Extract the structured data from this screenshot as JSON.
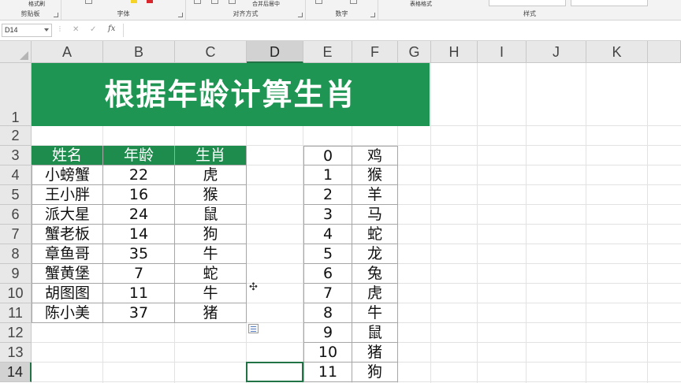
{
  "ribbon": {
    "groups": [
      {
        "label": "剪贴板",
        "button": "格式刷"
      },
      {
        "label": "字体"
      },
      {
        "label": "对齐方式",
        "button": "合并后居中"
      },
      {
        "label": "数字"
      },
      {
        "label": "样式",
        "button": "表格格式"
      }
    ],
    "colors": {
      "highlight": "#f5d327",
      "font_color": "#d9262c"
    }
  },
  "formula_bar": {
    "name_box": "D14",
    "cancel_icon": "✕",
    "enter_icon": "✓",
    "fx_label": "fx",
    "content": ""
  },
  "sheet": {
    "columns": [
      "A",
      "B",
      "C",
      "D",
      "E",
      "F",
      "G",
      "H",
      "I",
      "J",
      "K"
    ],
    "rows": [
      "1",
      "2",
      "3",
      "4",
      "5",
      "6",
      "7",
      "8",
      "9",
      "10",
      "11",
      "12",
      "13",
      "14"
    ],
    "selected_cell": "D14",
    "title": "根据年龄计算生肖",
    "main_table": {
      "headers": [
        "姓名",
        "年龄",
        "生肖"
      ],
      "rows": [
        [
          "小螃蟹",
          "22",
          "虎"
        ],
        [
          "王小胖",
          "16",
          "猴"
        ],
        [
          "派大星",
          "24",
          "鼠"
        ],
        [
          "蟹老板",
          "14",
          "狗"
        ],
        [
          "章鱼哥",
          "35",
          "牛"
        ],
        [
          "蟹黄堡",
          "7",
          "蛇"
        ],
        [
          "胡图图",
          "11",
          "牛"
        ],
        [
          "陈小美",
          "37",
          "猪"
        ]
      ]
    },
    "lookup_table": [
      [
        "0",
        "鸡"
      ],
      [
        "1",
        "猴"
      ],
      [
        "2",
        "羊"
      ],
      [
        "3",
        "马"
      ],
      [
        "4",
        "蛇"
      ],
      [
        "5",
        "龙"
      ],
      [
        "6",
        "兔"
      ],
      [
        "7",
        "虎"
      ],
      [
        "8",
        "牛"
      ],
      [
        "9",
        "鼠"
      ],
      [
        "10",
        "猪"
      ],
      [
        "11",
        "狗"
      ]
    ]
  },
  "theme": {
    "header_green": "#1e8c4d",
    "title_green": "#1e9553",
    "selection_green": "#217346"
  }
}
